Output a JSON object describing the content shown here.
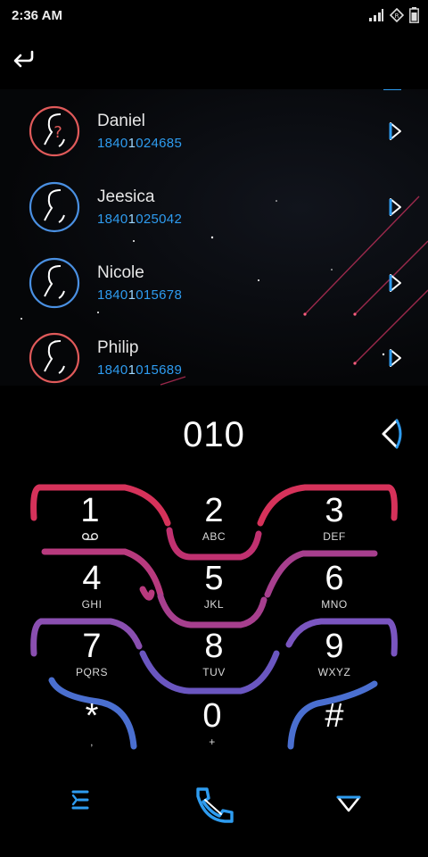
{
  "status": {
    "time": "2:36 AM",
    "icons": [
      "data-icon",
      "signal-icon",
      "vpn-icon",
      "battery-icon"
    ]
  },
  "contacts": [
    {
      "name": "Daniel",
      "number_pre": "1840",
      "number_hl": "1",
      "number_post": "024685",
      "avatar_color": "#e05a5a"
    },
    {
      "name": "Jeesica",
      "number_pre": "1840",
      "number_hl": "1",
      "number_post": "025042",
      "avatar_color": "#4a90e2"
    },
    {
      "name": "Nicole",
      "number_pre": "1840",
      "number_hl": "1",
      "number_post": "015678",
      "avatar_color": "#4a90e2"
    },
    {
      "name": "Philip",
      "number_pre": "1840",
      "number_hl": "1",
      "number_post": "015689",
      "avatar_color": "#e05a5a"
    }
  ],
  "dialer": {
    "input": "010"
  },
  "keys": [
    {
      "digit": "1",
      "letters": ""
    },
    {
      "digit": "2",
      "letters": "ABC"
    },
    {
      "digit": "3",
      "letters": "DEF"
    },
    {
      "digit": "4",
      "letters": "GHI"
    },
    {
      "digit": "5",
      "letters": "JKL"
    },
    {
      "digit": "6",
      "letters": "MNO"
    },
    {
      "digit": "7",
      "letters": "PQRS"
    },
    {
      "digit": "8",
      "letters": "TUV"
    },
    {
      "digit": "9",
      "letters": "WXYZ"
    },
    {
      "digit": "*",
      "letters": ","
    },
    {
      "digit": "0",
      "letters": "+"
    },
    {
      "digit": "#",
      "letters": ""
    }
  ],
  "colors": {
    "accent_blue": "#2e9cf0",
    "row1": "#d6325a",
    "row2": "#a73f8e",
    "row3": "#7a55c0",
    "row4": "#4a6fd0"
  }
}
